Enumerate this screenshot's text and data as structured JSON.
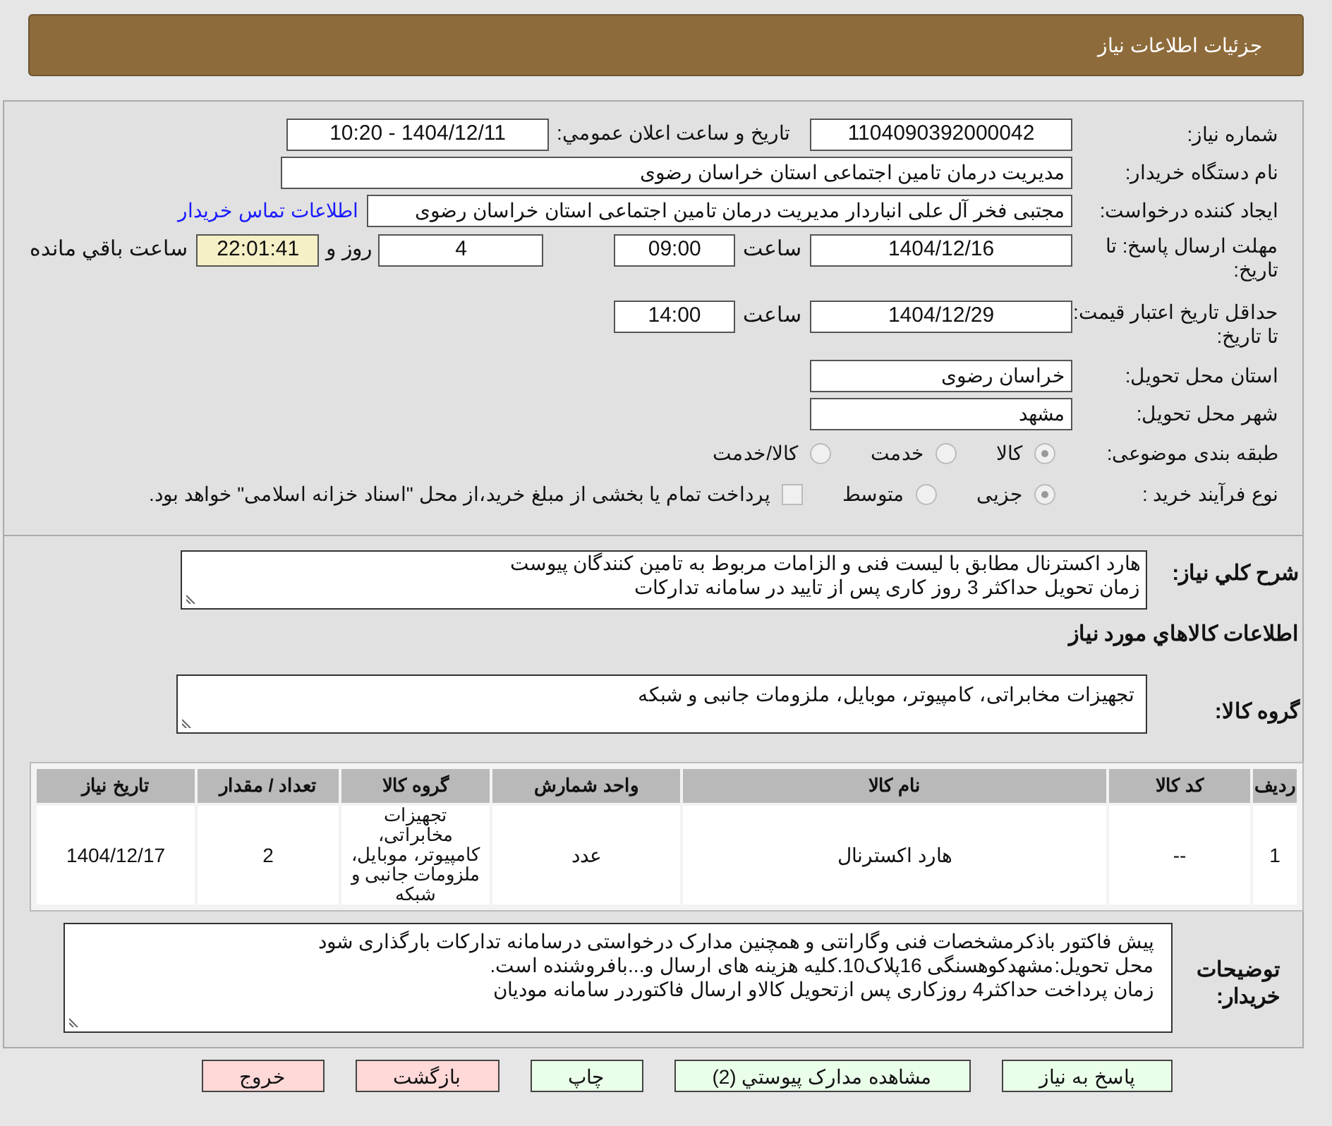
{
  "header": {
    "title": "جزئیات اطلاعات نیاز"
  },
  "need_number": {
    "label": "شماره نیاز:",
    "value": "1104090392000042"
  },
  "announce": {
    "label": "تاریخ و ساعت اعلان عمومي:",
    "value": "1404/12/11 - 10:20"
  },
  "buyer": {
    "label": "نام دستگاه خریدار:",
    "value": "مدیریت درمان تامین اجتماعی استان خراسان رضوی"
  },
  "requester": {
    "label": "ایجاد کننده درخواست:",
    "value": "مجتبی فخر آل علی انباردار مدیریت درمان تامین اجتماعی استان خراسان رضوی",
    "link": "اطلاعات تماس خریدار"
  },
  "deadline": {
    "label": "مهلت ارسال پاسخ: تا تاریخ:",
    "date": "1404/12/16",
    "time_label": "ساعت",
    "time": "09:00",
    "days": "4",
    "days_label": "روز و",
    "remaining": "22:01:41",
    "remaining_label": "ساعت باقي مانده"
  },
  "validity": {
    "label": "حداقل تاریخ اعتبار قیمت: تا تاریخ:",
    "date": "1404/12/29",
    "time_label": "ساعت",
    "time": "14:00"
  },
  "province": {
    "label": "استان محل تحویل:",
    "value": "خراسان رضوی"
  },
  "city": {
    "label": "شهر محل تحویل:",
    "value": "مشهد"
  },
  "category": {
    "label": "طبقه بندی موضوعی:",
    "options": [
      {
        "label": "کالا",
        "selected": true
      },
      {
        "label": "خدمت",
        "selected": false
      },
      {
        "label": "کالا/خدمت",
        "selected": false
      }
    ]
  },
  "process": {
    "label": "نوع فرآیند خرید :",
    "options": [
      {
        "label": "جزیی",
        "selected": true
      },
      {
        "label": "متوسط",
        "selected": false
      }
    ],
    "payment": {
      "checked": false,
      "label": "پرداخت تمام یا بخشی از مبلغ خرید،از محل \"اسناد خزانه اسلامی\" خواهد بود."
    }
  },
  "description": {
    "label": "شرح کلي نياز:",
    "lines": [
      "هارد اکسترنال مطابق با لیست فنی و الزامات مربوط به تامین کنندگان پیوست",
      "زمان تحویل حداکثر 3 روز کاری پس از تایید در سامانه تدارکات"
    ]
  },
  "goods_title": "اطلاعات کالاهاي مورد نياز",
  "goods_group": {
    "label": "گروه کالا:",
    "value": "تجهیزات مخابراتی، کامپیوتر، موبایل، ملزومات جانبی و شبکه"
  },
  "table": {
    "columns": [
      "ردیف",
      "کد کالا",
      "نام کالا",
      "واحد شمارش",
      "گروه کالا",
      "تعداد / مقدار",
      "تاریخ نیاز"
    ],
    "rows": [
      {
        "cells": [
          "1",
          "--",
          "هارد اکسترنال",
          "عدد",
          "تجهیزات مخابراتی، کامپیوتر، موبایل، ملزومات جانبی و شبکه",
          "2",
          "1404/12/17"
        ]
      }
    ]
  },
  "buyer_notes": {
    "label": "توضیحات خریدار:",
    "lines": [
      "پیش فاکتور باذکرمشخصات فنی وگارانتی و همچنین مدارک درخواستی درسامانه تدارکات بارگذاری شود",
      "محل تحویل:مشهدکوهسنگی 16پلاک10.کلیه هزینه های ارسال و...بافروشنده است.",
      "زمان پرداخت حداکثر4 روزکاری پس ازتحویل کالاو ارسال فاکتوردر سامانه مودیان"
    ]
  },
  "buttons": [
    {
      "label": "پاسخ به نياز",
      "kind": "normal"
    },
    {
      "label": "مشاهده مدارک پيوستي (2)",
      "kind": "normal"
    },
    {
      "label": "چاپ",
      "kind": "normal"
    },
    {
      "label": "بازگشت",
      "kind": "danger"
    },
    {
      "label": "خروج",
      "kind": "danger"
    }
  ]
}
